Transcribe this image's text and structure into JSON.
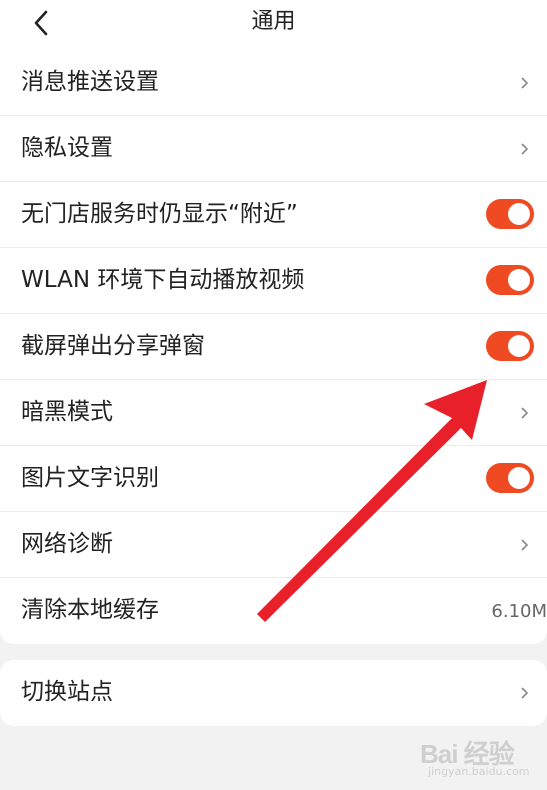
{
  "header": {
    "title": "通用",
    "back_icon": "chevron-left-icon"
  },
  "settings": [
    {
      "label": "消息推送设置",
      "control": "chevron"
    },
    {
      "label": "隐私设置",
      "control": "chevron"
    },
    {
      "label": "无门店服务时仍显示“附近”",
      "control": "toggle",
      "on": true
    },
    {
      "label": "WLAN 环境下自动播放视频",
      "control": "toggle",
      "on": true
    },
    {
      "label": "截屏弹出分享弹窗",
      "control": "toggle",
      "on": true
    },
    {
      "label": "暗黑模式",
      "control": "chevron"
    },
    {
      "label": "图片文字识别",
      "control": "toggle",
      "on": true
    },
    {
      "label": "网络诊断",
      "control": "chevron"
    },
    {
      "label": "清除本地缓存",
      "control": "value",
      "value": "6.10M"
    }
  ],
  "settings2": [
    {
      "label": "切换站点",
      "control": "chevron"
    }
  ],
  "colors": {
    "accent": "#f04a23",
    "annotation_arrow": "#e8202a",
    "background": "#f2f2f2"
  },
  "watermark": {
    "text": "Bai 经验",
    "sub": "jingyan.baidu.com"
  }
}
